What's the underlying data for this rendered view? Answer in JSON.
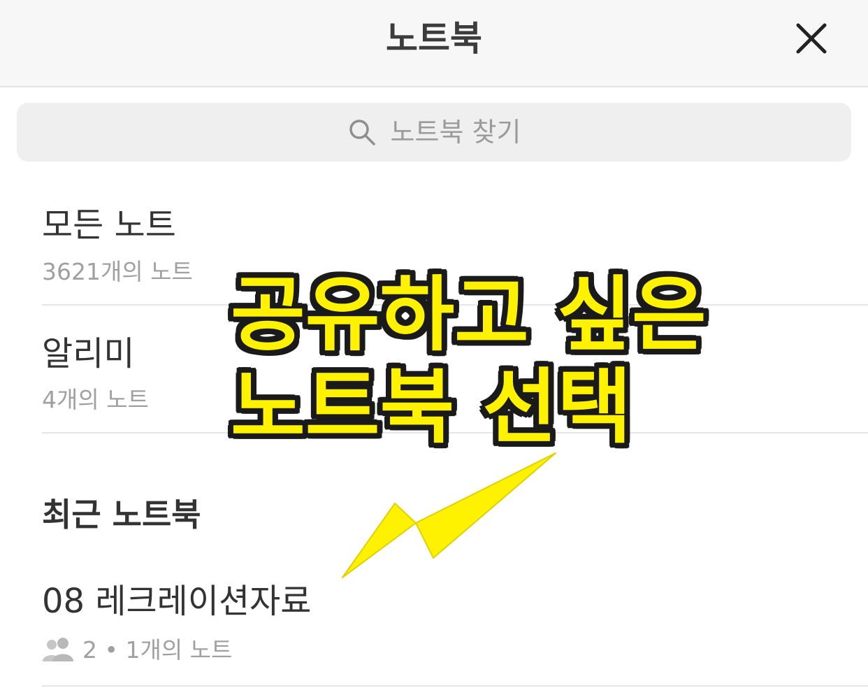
{
  "header": {
    "title": "노트북",
    "close_icon": "close-icon"
  },
  "search": {
    "placeholder": "노트북 찾기",
    "icon": "search-icon"
  },
  "items": [
    {
      "title": "모든 노트",
      "subtitle": "3621개의 노트"
    },
    {
      "title": "알리미",
      "subtitle": "4개의 노트"
    }
  ],
  "recent": {
    "section_title": "최근 노트북",
    "items": [
      {
        "title": "08 레크레이션자료",
        "shared_count": "2",
        "separator": "•",
        "note_count": "1개의 노트",
        "icon": "people-icon"
      }
    ]
  },
  "annotation": {
    "line1": "공유하고 싶은",
    "line2": "노트북 선택",
    "color": "#fff200"
  }
}
